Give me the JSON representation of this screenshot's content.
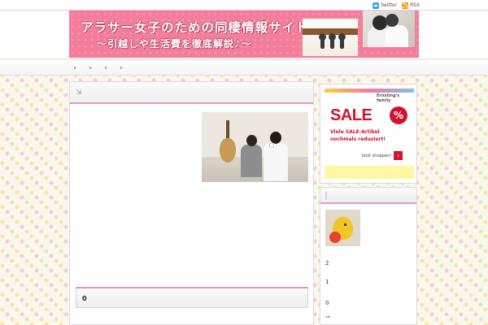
{
  "toplinks": {
    "twitter": "twitter",
    "rss": "RSS"
  },
  "banner": {
    "title": "アラサー女子のための同棲情報サイト",
    "subtitle": "〜引越しや生活費を徹底解説♪〜",
    "hearts": "♥ ♥"
  },
  "nav": {
    "items": [
      "▸",
      "▸",
      "▸",
      "▸"
    ]
  },
  "main": {
    "post_icon": "⇲",
    "comment_count": "0"
  },
  "ad": {
    "logo": "Ernsting's family",
    "sale": "SALE",
    "percent": "%",
    "line1": "Viele SALE-Artikel",
    "line2": "nochmals reduziert!",
    "button": "Jetzt shoppen!",
    "arrow": "›"
  },
  "sidebar": {
    "numbers": [
      "2",
      "1",
      "0"
    ],
    "more": "⇒"
  },
  "colors": {
    "pink_accent": "#e694c9",
    "banner_pink": "#f37d9b",
    "ad_red": "#d3122e"
  },
  "icons": {
    "twitter": "twitter-icon",
    "rss": "rss-icon",
    "post": "expand-icon"
  }
}
